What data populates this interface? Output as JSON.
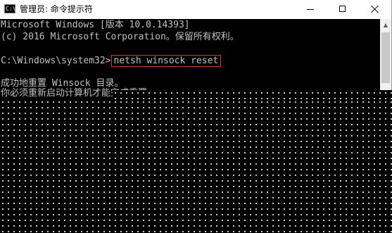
{
  "window": {
    "title": "管理员: 命令提示符",
    "icon": "cmd-icon",
    "icon_glyph": "C:\\",
    "controls": {
      "minimize": "minimize-icon",
      "maximize": "maximize-icon",
      "close": "close-icon"
    }
  },
  "console": {
    "lines": [
      "Microsoft Windows [版本 10.0.14393]",
      "(c) 2016 Microsoft Corporation。保留所有权利。",
      "",
      "成功地重置 Winsock 目录。",
      "你必须重新启动计算机才能完成重置。"
    ],
    "prompt": "C:\\Windows\\system32>",
    "command": "netsh winsock reset",
    "highlight_color": "#d23b3b",
    "text_color": "#c0c0c0",
    "background_color": "#000000"
  },
  "scrollbar": {
    "up_arrow": "▲"
  }
}
